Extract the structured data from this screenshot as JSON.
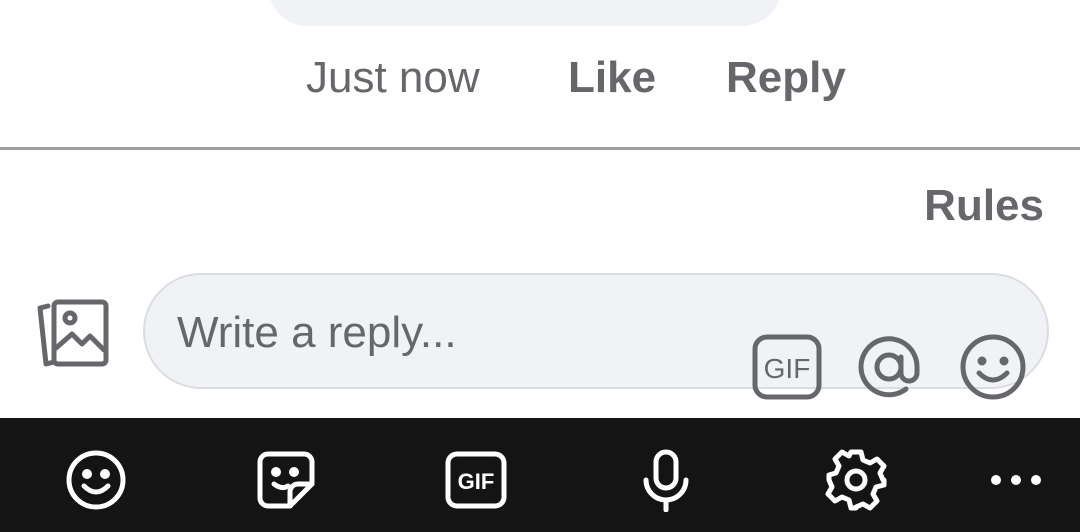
{
  "comment_meta": {
    "timestamp": "Just now",
    "like_label": "Like",
    "reply_label": "Reply"
  },
  "rules_link": "Rules",
  "reply_composer": {
    "placeholder": "Write a reply...",
    "icons": [
      "photo-icon",
      "gif-icon",
      "at-mention-icon",
      "emoji-icon"
    ],
    "gif_label": "GIF"
  },
  "keyboard_toolbar": {
    "icons": [
      "emoji-icon",
      "sticker-icon",
      "gif-icon",
      "microphone-icon",
      "settings-icon",
      "more-icon"
    ],
    "gif_label": "GIF"
  },
  "colors": {
    "text_secondary": "#65676b",
    "composer_bg": "#f0f2f5",
    "keyboard_bg": "#141414"
  }
}
